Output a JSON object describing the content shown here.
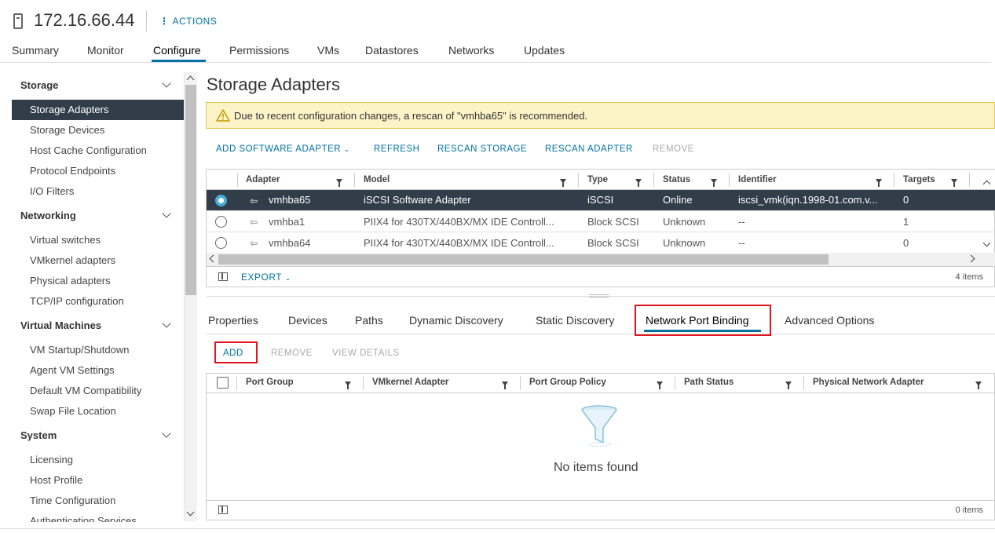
{
  "header": {
    "host": "172.16.66.44",
    "actions_label": "ACTIONS"
  },
  "top_tabs": [
    "Summary",
    "Monitor",
    "Configure",
    "Permissions",
    "VMs",
    "Datastores",
    "Networks",
    "Updates"
  ],
  "active_top_tab": "Configure",
  "sidebar": {
    "sections": [
      {
        "title": "Storage",
        "items": [
          "Storage Adapters",
          "Storage Devices",
          "Host Cache Configuration",
          "Protocol Endpoints",
          "I/O Filters"
        ]
      },
      {
        "title": "Networking",
        "items": [
          "Virtual switches",
          "VMkernel adapters",
          "Physical adapters",
          "TCP/IP configuration"
        ]
      },
      {
        "title": "Virtual Machines",
        "items": [
          "VM Startup/Shutdown",
          "Agent VM Settings",
          "Default VM Compatibility",
          "Swap File Location"
        ]
      },
      {
        "title": "System",
        "items": [
          "Licensing",
          "Host Profile",
          "Time Configuration",
          "Authentication Services"
        ]
      }
    ],
    "selected_item": "Storage Adapters"
  },
  "main": {
    "title": "Storage Adapters",
    "warning": "Due to recent configuration changes, a rescan of \"vmhba65\" is recommended.",
    "toolbar": {
      "add_software_adapter": "ADD SOFTWARE ADAPTER",
      "refresh": "REFRESH",
      "rescan_storage": "RESCAN STORAGE",
      "rescan_adapter": "RESCAN ADAPTER",
      "remove": "REMOVE"
    },
    "adapters_table": {
      "columns": [
        "Adapter",
        "Model",
        "Type",
        "Status",
        "Identifier",
        "Targets"
      ],
      "rows": [
        {
          "adapter": "vmhba65",
          "model": "iSCSI Software Adapter",
          "type": "iSCSI",
          "status": "Online",
          "identifier": "iscsi_vmk(iqn.1998-01.com.v...",
          "targets": "0",
          "selected": true
        },
        {
          "adapter": "vmhba1",
          "model": "PIIX4 for 430TX/440BX/MX IDE Controll...",
          "type": "Block SCSI",
          "status": "Unknown",
          "identifier": "--",
          "targets": "1",
          "selected": false
        },
        {
          "adapter": "vmhba64",
          "model": "PIIX4 for 430TX/440BX/MX IDE Controll...",
          "type": "Block SCSI",
          "status": "Unknown",
          "identifier": "--",
          "targets": "0",
          "selected": false
        }
      ],
      "export_label": "EXPORT",
      "count": "4 items"
    },
    "detail_tabs": [
      "Properties",
      "Devices",
      "Paths",
      "Dynamic Discovery",
      "Static Discovery",
      "Network Port Binding",
      "Advanced Options"
    ],
    "active_detail_tab": "Network Port Binding",
    "binding_toolbar": {
      "add": "ADD",
      "remove": "REMOVE",
      "view_details": "VIEW DETAILS"
    },
    "binding_table": {
      "columns": [
        "Port Group",
        "VMkernel Adapter",
        "Port Group Policy",
        "Path Status",
        "Physical Network Adapter"
      ],
      "empty_text": "No items found",
      "count": "0 items"
    }
  },
  "colors": {
    "accent": "#0072a3",
    "selected_row": "#313e4a",
    "warning_bg": "#fcf3c7",
    "highlight": "#e0141e"
  }
}
